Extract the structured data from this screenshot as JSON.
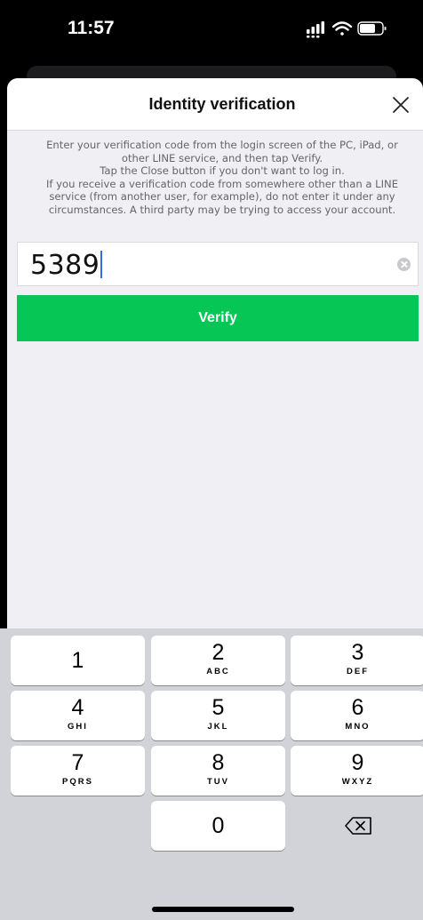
{
  "status_bar": {
    "time": "11:57"
  },
  "header": {
    "title": "Identity verification"
  },
  "instructions": [
    "Enter your verification code from the login screen of the PC, iPad, or",
    "other LINE service, and then tap Verify.",
    "Tap the Close button if you don't want to log in.",
    "If you receive a verification code from somewhere other than a LINE",
    "service (from another user, for example), do not enter it under any",
    "circumstances. A third party may be trying to access your account."
  ],
  "code_field": {
    "value": "5389"
  },
  "verify_button": {
    "label": "Verify"
  },
  "keypad": {
    "keys": [
      {
        "num": "1",
        "letters": ""
      },
      {
        "num": "2",
        "letters": "ABC"
      },
      {
        "num": "3",
        "letters": "DEF"
      },
      {
        "num": "4",
        "letters": "GHI"
      },
      {
        "num": "5",
        "letters": "JKL"
      },
      {
        "num": "6",
        "letters": "MNO"
      },
      {
        "num": "7",
        "letters": "PQRS"
      },
      {
        "num": "8",
        "letters": "TUV"
      },
      {
        "num": "9",
        "letters": "WXYZ"
      },
      {
        "num": "0",
        "letters": ""
      }
    ]
  },
  "colors": {
    "accent": "#06c755",
    "caret": "#2f6fe4"
  },
  "icons": [
    "signal-icon",
    "wifi-icon",
    "battery-icon",
    "close-icon",
    "clear-icon",
    "backspace-icon"
  ]
}
